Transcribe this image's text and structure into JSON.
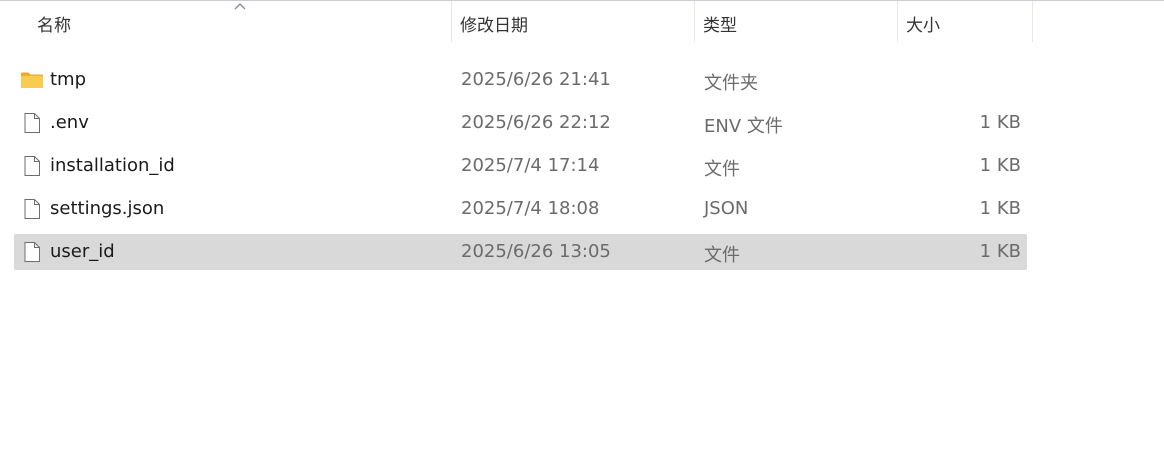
{
  "columns": {
    "name": "名称",
    "date": "修改日期",
    "type": "类型",
    "size": "大小"
  },
  "sort": {
    "column": "name",
    "direction": "ascending",
    "icon": "chevron-up-icon"
  },
  "files": [
    {
      "name": "tmp",
      "date": "2025/6/26 21:41",
      "type": "文件夹",
      "size": "",
      "icon": "folder-icon"
    },
    {
      "name": ".env",
      "date": "2025/6/26 22:12",
      "type": "ENV 文件",
      "size": "1 KB",
      "icon": "file-icon"
    },
    {
      "name": "installation_id",
      "date": "2025/7/4 17:14",
      "type": "文件",
      "size": "1 KB",
      "icon": "file-icon"
    },
    {
      "name": "settings.json",
      "date": "2025/7/4 18:08",
      "type": "JSON",
      "size": "1 KB",
      "icon": "file-icon"
    },
    {
      "name": "user_id",
      "date": "2025/6/26 13:05",
      "type": "文件",
      "size": "1 KB",
      "icon": "file-icon",
      "selected": true
    }
  ],
  "colors": {
    "selected_row": "#d9d9d9",
    "folder": "#f4c542",
    "muted_text": "#6b6b6b"
  }
}
